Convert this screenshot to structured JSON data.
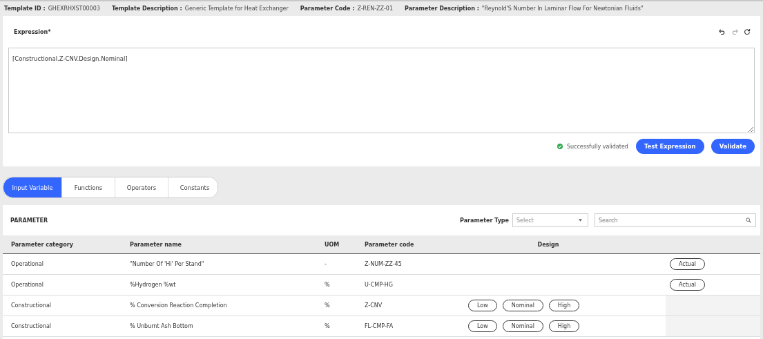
{
  "info_bar": [
    {
      "label": "Template ID :",
      "value": "GHEXRHXST00003"
    },
    {
      "label": "Template Description :",
      "value": "Generic Template for Heat Exchanger"
    },
    {
      "label": "Parameter Code :",
      "value": "Z-REN-ZZ-01"
    },
    {
      "label": "Parameter Description :",
      "value": "\"Reynold'S Number In Laminar Flow For Newtonian Fluids\""
    }
  ],
  "expression": {
    "label": "Expression*",
    "tools": [
      {
        "kind": "undo",
        "disabled": false
      },
      {
        "kind": "redo",
        "disabled": true
      },
      {
        "kind": "refresh",
        "disabled": false
      }
    ],
    "value": "[Constructional.Z-CNV.Design.Nominal]",
    "status": "Successfully validated",
    "buttons": [
      "Test Expression",
      "Validate"
    ]
  },
  "tabs": [
    {
      "label": "Input Variable",
      "selected": true
    },
    {
      "label": "Functions",
      "selected": false
    },
    {
      "label": "Operators",
      "selected": false
    },
    {
      "label": "Constants",
      "selected": false
    }
  ],
  "parameter_panel": {
    "title": "PARAMETER",
    "type_filter": {
      "label": "Parameter Type",
      "placeholder": "Select"
    },
    "search": {
      "placeholder": "Search"
    },
    "table": {
      "columns": [
        "Parameter category",
        "Parameter name",
        "UOM",
        "Parameter code",
        "Design"
      ],
      "rows": [
        {
          "category": "Operational",
          "name": "\"Number Of 'Hi' Per Stand\"",
          "uom": "-",
          "code": "Z-NUM-ZZ-45",
          "design": [],
          "actual": "Actual"
        },
        {
          "category": "Operational",
          "name": "%Hydrogen %wt",
          "uom": "%",
          "code": "U-CMP-HG",
          "design": [],
          "actual": "Actual"
        },
        {
          "category": "Constructional",
          "name": "% Conversion Reaction Completion",
          "uom": "%",
          "code": "Z-CNV",
          "design": [
            "Low",
            "Nominal",
            "High"
          ]
        },
        {
          "category": "Constructional",
          "name": "% Unburnt Ash Bottom",
          "uom": "%",
          "code": "FL-CMP-FA",
          "design": [
            "Low",
            "Nominal",
            "High"
          ]
        }
      ]
    }
  }
}
